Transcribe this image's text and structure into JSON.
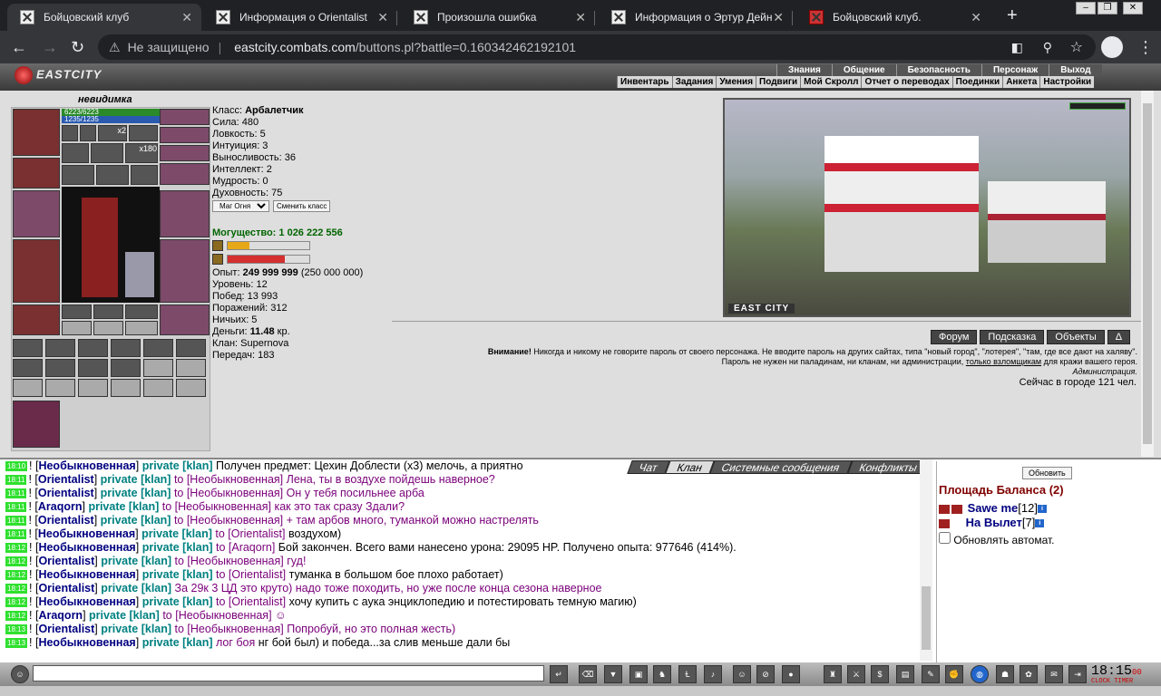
{
  "browser": {
    "tabs": [
      {
        "title": "Бойцовский клуб",
        "active": true
      },
      {
        "title": "Информация о Orientalist",
        "active": false
      },
      {
        "title": "Произошла ошибка",
        "active": false
      },
      {
        "title": "Информация о Эртур Дейн",
        "active": false
      },
      {
        "title": "Бойцовский клуб.",
        "active": false
      }
    ],
    "security": "Не защищено",
    "url_host": "eastcity.combats.com",
    "url_path": "/buttons.pl?battle=0.160342462192101"
  },
  "game": {
    "logo": "EASTCITY",
    "top_menu": [
      "Знания",
      "Общение",
      "Безопасность",
      "Персонаж",
      "Выход"
    ],
    "sub_menu": [
      "Инвентарь",
      "Задания",
      "Умения",
      "Подвиги",
      "Мой Скролл",
      "Отчет о переводах",
      "Поединки",
      "Анкета",
      "Настройки"
    ],
    "character": {
      "name": "невидимка",
      "hp": "6223/6223",
      "mp": "1235/1235",
      "class_label": "Класс:",
      "class_value": "Арбалетчик",
      "stats": [
        "Сила: 480",
        "Ловкость: 5",
        "Интуиция: 3",
        "Выносливость: 36",
        "Интеллект: 2",
        "Мудрость: 0",
        "Духовность: 75"
      ],
      "class_select": "Маг Огня",
      "change_class": "Сменить класс",
      "power": "Могущество: 1 026 222 556",
      "xp_fraction": 0.27,
      "energy_fraction": 0.7,
      "exp_label": "Опыт:",
      "exp_value": "249 999 999",
      "exp_next": "(250 000 000)",
      "level": "Уровень: 12",
      "wins": "Побед: 13 993",
      "losses": "Поражений: 312",
      "draws": "Ничьих: 5",
      "money_label": "Деньги:",
      "money_value": "11.48",
      "money_unit": "кр.",
      "clan": "Клан: Supernova",
      "transfers": "Передач: 183",
      "badge_x2": "x2",
      "badge_x180": "x180"
    },
    "location_label": "EAST CITY",
    "buttons": [
      "Форум",
      "Подсказка",
      "Объекты",
      "Δ"
    ],
    "warning_bold": "Внимание!",
    "warning_text": "Никогда и никому не говорите пароль от своего персонажа. Не вводите пароль на других сайтах, типа \"новый город\", \"лотерея\", \"там, где все дают на халяву\".",
    "warning_line2a": "Пароль не нужен ни паладинам, ни кланам, ни администрации,",
    "warning_link": "только взломщикам",
    "warning_line2b": "для кражи вашего героя.",
    "warning_sign": "Администрация.",
    "online": "Сейчас в городе 121 чел."
  },
  "chat": {
    "tabs": [
      "Чат",
      "Клан",
      "Системные сообщения",
      "Конфликты"
    ],
    "messages": [
      {
        "time": "18:10",
        "nick": "Необыкновенная",
        "ch": "private [klan]",
        "to": "",
        "text": "Получен предмет: Цехин Доблести (x3) мелочь, а приятно"
      },
      {
        "time": "18:11",
        "nick": "Orientalist",
        "ch": "private [klan]",
        "to": "to [Необыкновенная]",
        "text": "Лена, ты в воздухе пойдешь наверное?"
      },
      {
        "time": "18:11",
        "nick": "Orientalist",
        "ch": "private [klan]",
        "to": "to [Необыкновенная]",
        "text": "Он у тебя посильнее арба"
      },
      {
        "time": "18:11",
        "nick": "Araqorn",
        "ch": "private [klan]",
        "to": "to [Необыкновенная]",
        "text": "как это так сразу Здали?"
      },
      {
        "time": "18:11",
        "nick": "Orientalist",
        "ch": "private [klan]",
        "to": "to [Необыкновенная]",
        "text": "+ там арбов много, туманкой можно настрелять"
      },
      {
        "time": "18:11",
        "nick": "Необыкновенная",
        "ch": "private [klan]",
        "to": "to [Orientalist]",
        "text": "воздухом)"
      },
      {
        "time": "18:12",
        "nick": "Необыкновенная",
        "ch": "private [klan]",
        "to": "to [Araqorn]",
        "text": "Бой закончен. Всего вами нанесено урона: 29095 HP. Получено опыта: 977646 (414%)."
      },
      {
        "time": "18:12",
        "nick": "Orientalist",
        "ch": "private [klan]",
        "to": "to [Необыкновенная]",
        "text": "гуд!"
      },
      {
        "time": "18:12",
        "nick": "Необыкновенная",
        "ch": "private [klan]",
        "to": "to [Orientalist]",
        "text": "туманка в большом бое плохо работает)"
      },
      {
        "time": "18:12",
        "nick": "Orientalist",
        "ch": "private [klan]",
        "to": "",
        "text": "За 29к 3 ЦД это круто) надо тоже походить, но уже после конца сезона наверное"
      },
      {
        "time": "18:12",
        "nick": "Необыкновенная",
        "ch": "private [klan]",
        "to": "to [Orientalist]",
        "text": "хочу купить с аука энциклопедию и потестировать темную магию)"
      },
      {
        "time": "18:12",
        "nick": "Araqorn",
        "ch": "private [klan]",
        "to": "to [Необыкновенная]",
        "text": "☺"
      },
      {
        "time": "18:13",
        "nick": "Orientalist",
        "ch": "private [klan]",
        "to": "to [Необыкновенная]",
        "text": "Попробуй, но это полная жесть)"
      },
      {
        "time": "18:13",
        "nick": "Необыкновенная",
        "ch": "private [klan]",
        "to": "лог боя",
        "text": "нг бой был) и победа...за слив меньше дали бы"
      }
    ]
  },
  "room": {
    "refresh": "Обновить",
    "title": "Площадь Баланса (2)",
    "players": [
      {
        "name": "Sawe me",
        "level": "[12]"
      },
      {
        "name": "На Вылет",
        "level": "[7]"
      }
    ],
    "auto_update": "Обновлять автомат."
  },
  "clock": {
    "time": "18:15",
    "seconds": "00",
    "label1": "CLOCK",
    "label2": "TIMER"
  }
}
